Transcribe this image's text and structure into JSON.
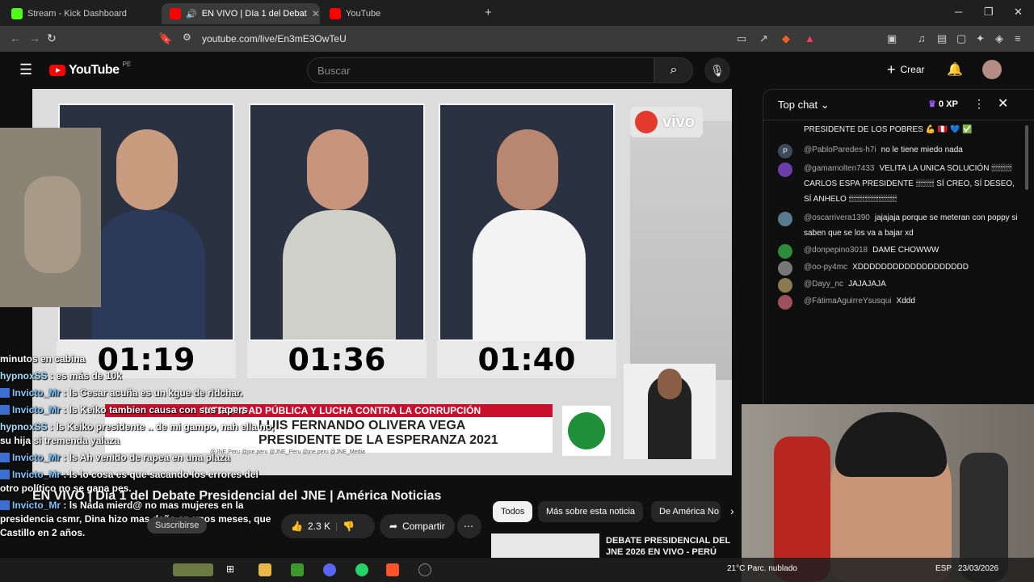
{
  "browser": {
    "tabs": [
      {
        "label": "Stream - Kick Dashboard",
        "active": false,
        "color": "#53fc18"
      },
      {
        "label": "EN VIVO | Día 1 del Debat",
        "active": true,
        "color": "#ff0000"
      },
      {
        "label": "YouTube",
        "active": false,
        "color": "#ff0000"
      }
    ],
    "new_tab": "+",
    "url": "youtube.com/live/En3mE3OwTeU"
  },
  "youtube": {
    "logo_text": "YouTube",
    "region": "PE",
    "search_placeholder": "Buscar",
    "create_label": "Crear"
  },
  "video": {
    "badge": "vivo",
    "timers": [
      "01:19",
      "01:36",
      "01:40"
    ],
    "banner_red": "INTEGRIDAD PÚBLICA Y LUCHA CONTRA LA CORRUPCIÓN",
    "banner_line1": "LUIS FERNANDO OLIVERA VEGA",
    "banner_line2": "PRESIDENTE DE LA ESPERANZA 2021",
    "handles": "@JNE.Peru  @jne.peru  @JNE_Peru  @jne.peru  @JNE_Media",
    "title": "EN VIVO | Día 1 del Debate Presidencial del JNE | América Noticias",
    "likes": "2.3 K",
    "share_label": "Compartir",
    "subscribe_label": "Suscribirse"
  },
  "stream_chat": [
    {
      "nick": "",
      "text": "minutos en cabina"
    },
    {
      "nick": "hypnoxSS",
      "text": "es más de 10k"
    },
    {
      "nick": "Invicto_Mr",
      "text": "ls Cesar acuña es un kgue de ridchar."
    },
    {
      "nick": "Invicto_Mr",
      "text": "ls Keiko tambien causa con sus tapers"
    },
    {
      "nick": "hypnoxSS",
      "text": "ls Keiko presidente .. de mi gampo, nah ella no, su hija si tremenda yalaza"
    },
    {
      "nick": "Invicto_Mr",
      "text": "ls Ah venido de rapea en una plaza"
    },
    {
      "nick": "Invicto_Mr",
      "text": "ls lo cosa es que sacando los errores del otro político no se gana pes."
    },
    {
      "nick": "Invicto_Mr",
      "text": "ls Nada mierd@ no mas mujeres en la presidencia csmr, Dina hizo mas daño en unos meses, que Castillo en 2 años."
    }
  ],
  "chips": [
    "Todos",
    "Más sobre esta noticia",
    "De América No"
  ],
  "reco": {
    "title": "DEBATE PRESIDENCIAL DEL JNE 2026 EN VIVO - PERÚ"
  },
  "live_chat": {
    "header": "Top chat",
    "xp": "0 XP",
    "messages": [
      {
        "author": "",
        "text": "PRESIDENTE DE LOS POBRES 💪 🇵🇪 💙 ✅",
        "avatar": ""
      },
      {
        "author": "@PabloParedes-h7i",
        "text": "no le tiene miedo nada",
        "avatar": "P"
      },
      {
        "author": "@gamamolten7433",
        "text": "VELITA LA UNICA SOLUCIÓN 🕯🕯🕯🕯🕯🕯🕯🕯🕯 CARLOS ESPA PRESIDENTE 🕯🕯🕯🕯🕯🕯🕯🕯 SÍ CREO, SÍ DESEO, SÍ ANHELO 🕯🕯🕯🕯🕯🕯🕯🕯🕯🕯🕯🕯🕯🕯🕯🕯🕯🕯🕯🕯🕯",
        "avatar": ""
      },
      {
        "author": "@oscarrivera1390",
        "text": "jajajaja porque se meteran con poppy si saben que se los va a bajar xd",
        "avatar": ""
      },
      {
        "author": "@donpepino3018",
        "text": "DAME CHOWWW",
        "avatar": ""
      },
      {
        "author": "@oo-py4mc",
        "text": "XDDDDDDDDDDDDDDDDDDD",
        "avatar": ""
      },
      {
        "author": "@Dayy_nc",
        "text": "JAJAJAJA",
        "avatar": ""
      },
      {
        "author": "@FátimaAguirreYsusqui",
        "text": "Xddd",
        "avatar": ""
      }
    ]
  },
  "taskbar": {
    "weather": "21°C  Parc. nublado",
    "lang": "ESP",
    "date": "23/03/2026"
  }
}
